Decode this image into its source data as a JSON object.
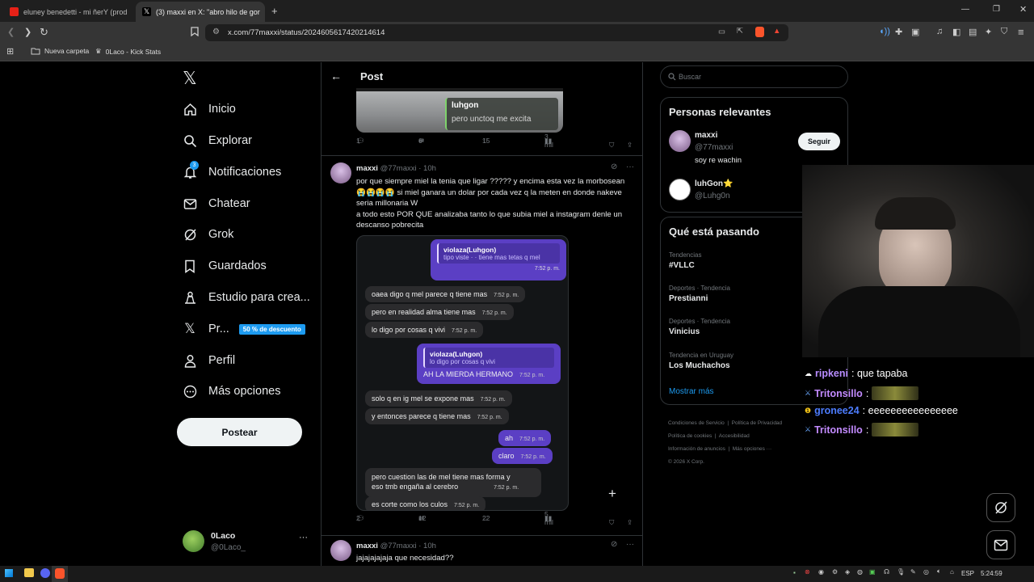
{
  "browser": {
    "tabs": [
      {
        "label": "eluney benedetti - mi ñerY (prod"
      },
      {
        "label": "(3) maxxi en X: \"abro hilo de gor"
      }
    ],
    "url": "x.com/77maxxi/status/2024605617420214614",
    "bookmarks": [
      {
        "label": "Nueva carpeta"
      },
      {
        "label": "0Laco - Kick Stats"
      }
    ]
  },
  "nav": {
    "items": [
      {
        "label": "Inicio",
        "icon": "home-icon"
      },
      {
        "label": "Explorar",
        "icon": "search-icon"
      },
      {
        "label": "Notificaciones",
        "icon": "bell-icon",
        "badge": "3"
      },
      {
        "label": "Chatear",
        "icon": "mail-icon"
      },
      {
        "label": "Grok",
        "icon": "grok-icon"
      },
      {
        "label": "Guardados",
        "icon": "bookmark-icon"
      },
      {
        "label": "Estudio para crea...",
        "icon": "studio-icon"
      },
      {
        "label": "Pr...",
        "icon": "x-icon",
        "promo": "50 % de descuento"
      },
      {
        "label": "Perfil",
        "icon": "person-icon"
      },
      {
        "label": "Más opciones",
        "icon": "more-icon"
      }
    ],
    "post_button": "Postear",
    "account": {
      "name": "0Laco",
      "handle": "@0Laco_"
    }
  },
  "main": {
    "header_title": "Post",
    "top_image_tag": {
      "name": "luhgon",
      "text": "pero unctoq me excita"
    },
    "top_actions": {
      "replies": "1",
      "reposts": "6",
      "likes": "15",
      "views": "3 mil"
    },
    "tweet": {
      "author": "maxxi",
      "handle": "@77maxxi",
      "time": "· 10h",
      "line1": "por que siempre miel la tenia que ligar ????? y encima esta vez la morbosean",
      "line2": "😭😭😭😭 si miel ganara un dolar por cada vez q la meten en donde nakeve",
      "line3": "seria millonaria W",
      "line4": "a todo esto POR QUE analizaba tanto lo que subia miel a instagram denle un",
      "line5": "descanso pobrecita",
      "actions": {
        "replies": "2",
        "reposts": "12",
        "likes": "22",
        "views": "5 mil"
      }
    },
    "chat": {
      "quote1_name": "violaza(Luhgon)",
      "quote1_text": "tipo viste ·  ·  tiene mas tetas q mel",
      "quote1_time": "7:52 p. m.",
      "m1": "oaea digo q mel parece q tiene mas",
      "m2": "pero en realidad alma tiene mas",
      "m3": "lo digo por cosas q vivi",
      "quote2_name": "violaza(Luhgon)",
      "quote2_text": "lo digo por cosas q vivi",
      "m4": "AH LA MIERDA HERMANO",
      "m5": "solo q en ig mel se expone mas",
      "m6": "y entonces parece q tiene mas",
      "m7": "ah",
      "m8": "claro",
      "m9a": "pero cuestion las de mel tiene mas forma y",
      "m9b": "eso tmb engaña al cerebro",
      "m10": "es corte como los culos",
      "time": "7:52 p. m."
    },
    "next_tweet": {
      "author": "maxxi",
      "handle": "@77maxxi",
      "time": "· 10h",
      "text": "jajajajajaja que necesidad??"
    }
  },
  "right": {
    "search_placeholder": "Buscar",
    "relevant_title": "Personas relevantes",
    "people": [
      {
        "name": "maxxi",
        "handle": "@77maxxi",
        "bio": "soy re wachin",
        "button": "Seguir"
      },
      {
        "name": "luhGon⭐",
        "handle": "@Luhg0n"
      }
    ],
    "trending_title": "Qué está pasando",
    "trends": [
      {
        "category": "Tendencias",
        "name": "#VLLC"
      },
      {
        "category": "Deportes · Tendencia",
        "name": "Prestianni"
      },
      {
        "category": "Deportes · Tendencia",
        "name": "Vinicius"
      },
      {
        "category": "Tendencia en Uruguay",
        "name": "Los Muchachos"
      }
    ],
    "show_more": "Mostrar más",
    "footer": {
      "l1a": "Condiciones de Servicio",
      "l1b": "Política de Privacidad",
      "l2a": "Política de cookies",
      "l2b": "Accesibilidad",
      "l3a": "Información de anuncios",
      "l3b": "Más opciones ···",
      "l4": "© 2026 X Corp."
    }
  },
  "stream_chat": [
    {
      "user": "ripkeni",
      "color": "#b88cff",
      "text": ": que tapaba"
    },
    {
      "user": "Tritonsillo",
      "color": "#c38bff",
      "text": ":",
      "gif": true
    },
    {
      "user": "gronee24",
      "color": "#4d7dff",
      "text": ": eeeeeeeeeeeeeeee"
    },
    {
      "user": "Tritonsillo",
      "color": "#c38bff",
      "text": ":",
      "gif": true
    }
  ],
  "taskbar": {
    "lang": "ESP",
    "time": "5:24:59"
  }
}
